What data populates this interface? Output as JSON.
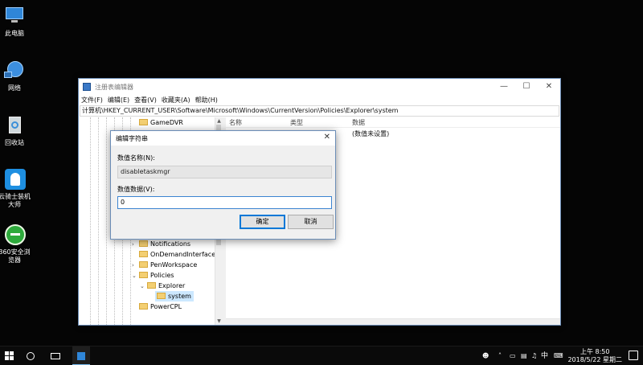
{
  "desktop": {
    "icons": [
      {
        "label": "此电脑",
        "icon": "computer-icon"
      },
      {
        "label": "网络",
        "icon": "network-icon"
      },
      {
        "label": "回收站",
        "icon": "recycle-bin-icon"
      },
      {
        "label": "云骑士装机大师",
        "icon": "yunqishi-icon"
      },
      {
        "label": "360安全浏览器",
        "icon": "browser-360-icon"
      }
    ]
  },
  "window": {
    "title": "注册表编辑器",
    "menu": [
      "文件(F)",
      "编辑(E)",
      "查看(V)",
      "收藏夹(A)",
      "帮助(H)"
    ],
    "address": "计算机\\HKEY_CURRENT_USER\\Software\\Microsoft\\Windows\\CurrentVersion\\Policies\\Explorer\\system",
    "tree": [
      {
        "label": "GameDVR"
      },
      {
        "label": "Notifications"
      },
      {
        "label": "OnDemandInterfaceC"
      },
      {
        "label": "PenWorkspace"
      },
      {
        "label": "Policies"
      },
      {
        "label": "Explorer"
      },
      {
        "label": "system"
      },
      {
        "label": "PowerCPL"
      }
    ],
    "columns": [
      "名称",
      "类型",
      "数据"
    ],
    "list_row_data": "(数值未设置)"
  },
  "dialog": {
    "title": "编辑字符串",
    "name_label": "数值名称(N):",
    "name_value": "disabletaskmgr",
    "data_label": "数值数据(V):",
    "data_value": "0",
    "ok": "确定",
    "cancel": "取消"
  },
  "taskbar": {
    "ime": "中",
    "time": "上午 8:50",
    "date": "2018/5/22 星期二"
  }
}
